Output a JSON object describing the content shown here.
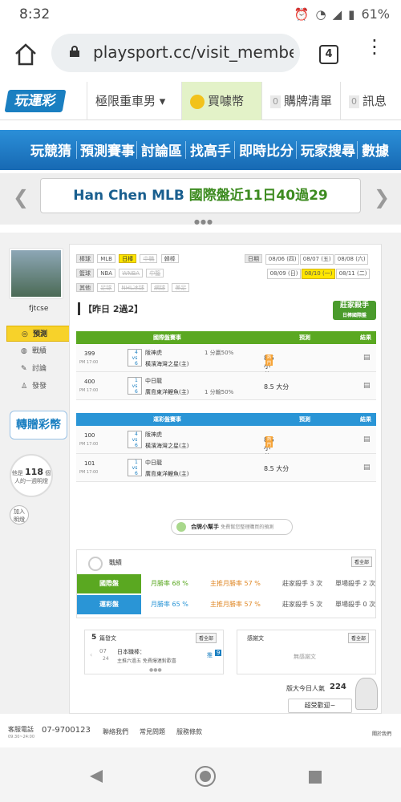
{
  "status": {
    "time": "8:32",
    "battery": "61%"
  },
  "browser": {
    "url": "playsport.cc/visit_membe",
    "tab_count": "4"
  },
  "site": {
    "logo": "玩運彩",
    "header": {
      "user": "極限重車男 ▾",
      "buy": "買噱幣",
      "cart_count": "0",
      "cart": "購牌清單",
      "msg_count": "0",
      "msg": "訊息"
    },
    "nav": [
      "玩競猜",
      "預測賽事",
      "討論區",
      "找高手",
      "即時比分",
      "玩家搜尋",
      "數據"
    ]
  },
  "banner": {
    "name": "Han Chen",
    "league": "MLB",
    "text": "國際盤近11日40過29"
  },
  "profile": {
    "username": "fjtcse",
    "menu": [
      "預測",
      "戰績",
      "討論",
      "發發"
    ],
    "gift": "轉贈彩幣",
    "circle_top": "他是",
    "circle_count": "118",
    "circle_unit": "個",
    "circle_bottom": "人的一週明燈",
    "join_line1": "加入",
    "join_line2": "明燈"
  },
  "filters": {
    "row1_label": "棒球",
    "row1": [
      "MLB",
      "日棒",
      "中職",
      "韓棒"
    ],
    "row2_label": "籃球",
    "row2": [
      "NBA",
      "WNBA",
      "中籃"
    ],
    "row3_label": "其他",
    "row3": [
      "足球",
      "NHL冰球",
      "網球",
      "美足"
    ],
    "date_label": "日期",
    "dates_row1": [
      "08/06 (四)",
      "08/07 (五)",
      "08/08 (六)"
    ],
    "dates_row2": [
      "08/09 (日)",
      "08/10 (一)",
      "08/11 (二)"
    ]
  },
  "record": "【昨日 2過2】",
  "badge": {
    "line1": "莊家殺手",
    "line2": "日棒國際盤"
  },
  "table_intl": {
    "header": [
      "國際盤賽事",
      "預測",
      "結果"
    ],
    "rows": [
      {
        "no": "399",
        "time": "PM 17:00",
        "away_no": "4",
        "home_no": "6",
        "away": "阪神虎",
        "home": "橫濱海灣之星(主)",
        "line": "1 分贏50%",
        "pick": "8.5 小分",
        "hot": "熱門"
      },
      {
        "no": "400",
        "time": "PM 17:00",
        "away_no": "1",
        "home_no": "6",
        "away": "中日龍",
        "home": "廣島東洋鯉魚(主)",
        "line": "1 分輸50%",
        "pick": "8.5 大分",
        "hot": ""
      }
    ]
  },
  "table_local": {
    "header": [
      "運彩盤賽事",
      "預測",
      "結果"
    ],
    "rows": [
      {
        "no": "100",
        "time": "PM 17:00",
        "away_no": "4",
        "home_no": "6",
        "away": "阪神虎",
        "home": "橫濱海灣之星(主)",
        "line": "",
        "pick": "8.5 小分",
        "hot": "熱門"
      },
      {
        "no": "101",
        "time": "PM 17:00",
        "away_no": "1",
        "home_no": "6",
        "away": "中日龍",
        "home": "廣島東洋鯉魚(主)",
        "line": "",
        "pick": "8.5 大分",
        "hot": ""
      }
    ]
  },
  "helper": {
    "title": "合牌小幫手",
    "desc": "免費幫您整理購買的預測"
  },
  "stats": {
    "title": "戰績",
    "view_all": "看全部",
    "rows": [
      {
        "label": "國際盤",
        "month": "月勝率 68 %",
        "main": "主推月勝率 57 %",
        "killer": "莊家殺手 3 次",
        "single": "單場殺手 2 次"
      },
      {
        "label": "運彩盤",
        "month": "月勝率 65 %",
        "main": "主推月勝率 57 %",
        "killer": "莊家殺手 5 次",
        "single": "單場殺手 0 次"
      }
    ]
  },
  "posts": {
    "count": "5",
    "title": "篇發文",
    "view_all": "看全部",
    "date_m": "07",
    "date_d": "24",
    "post_title": "日本職棒：",
    "post_desc": "主推六過五 免費爆連對歡喜",
    "reply_label": "推",
    "reply": "9"
  },
  "thanks": {
    "title": "感謝文",
    "view_all": "看全部",
    "empty": "無感謝文"
  },
  "popularity": {
    "label": "版大今日人氣",
    "value": "224",
    "welcome": "超受歡迎~"
  },
  "footer": {
    "service_label": "客服電話",
    "hours": "09:30~24:00",
    "phone": "07-9700123",
    "links": [
      "聯絡我們",
      "常見問題",
      "服務條款"
    ],
    "about": "關於我們"
  }
}
